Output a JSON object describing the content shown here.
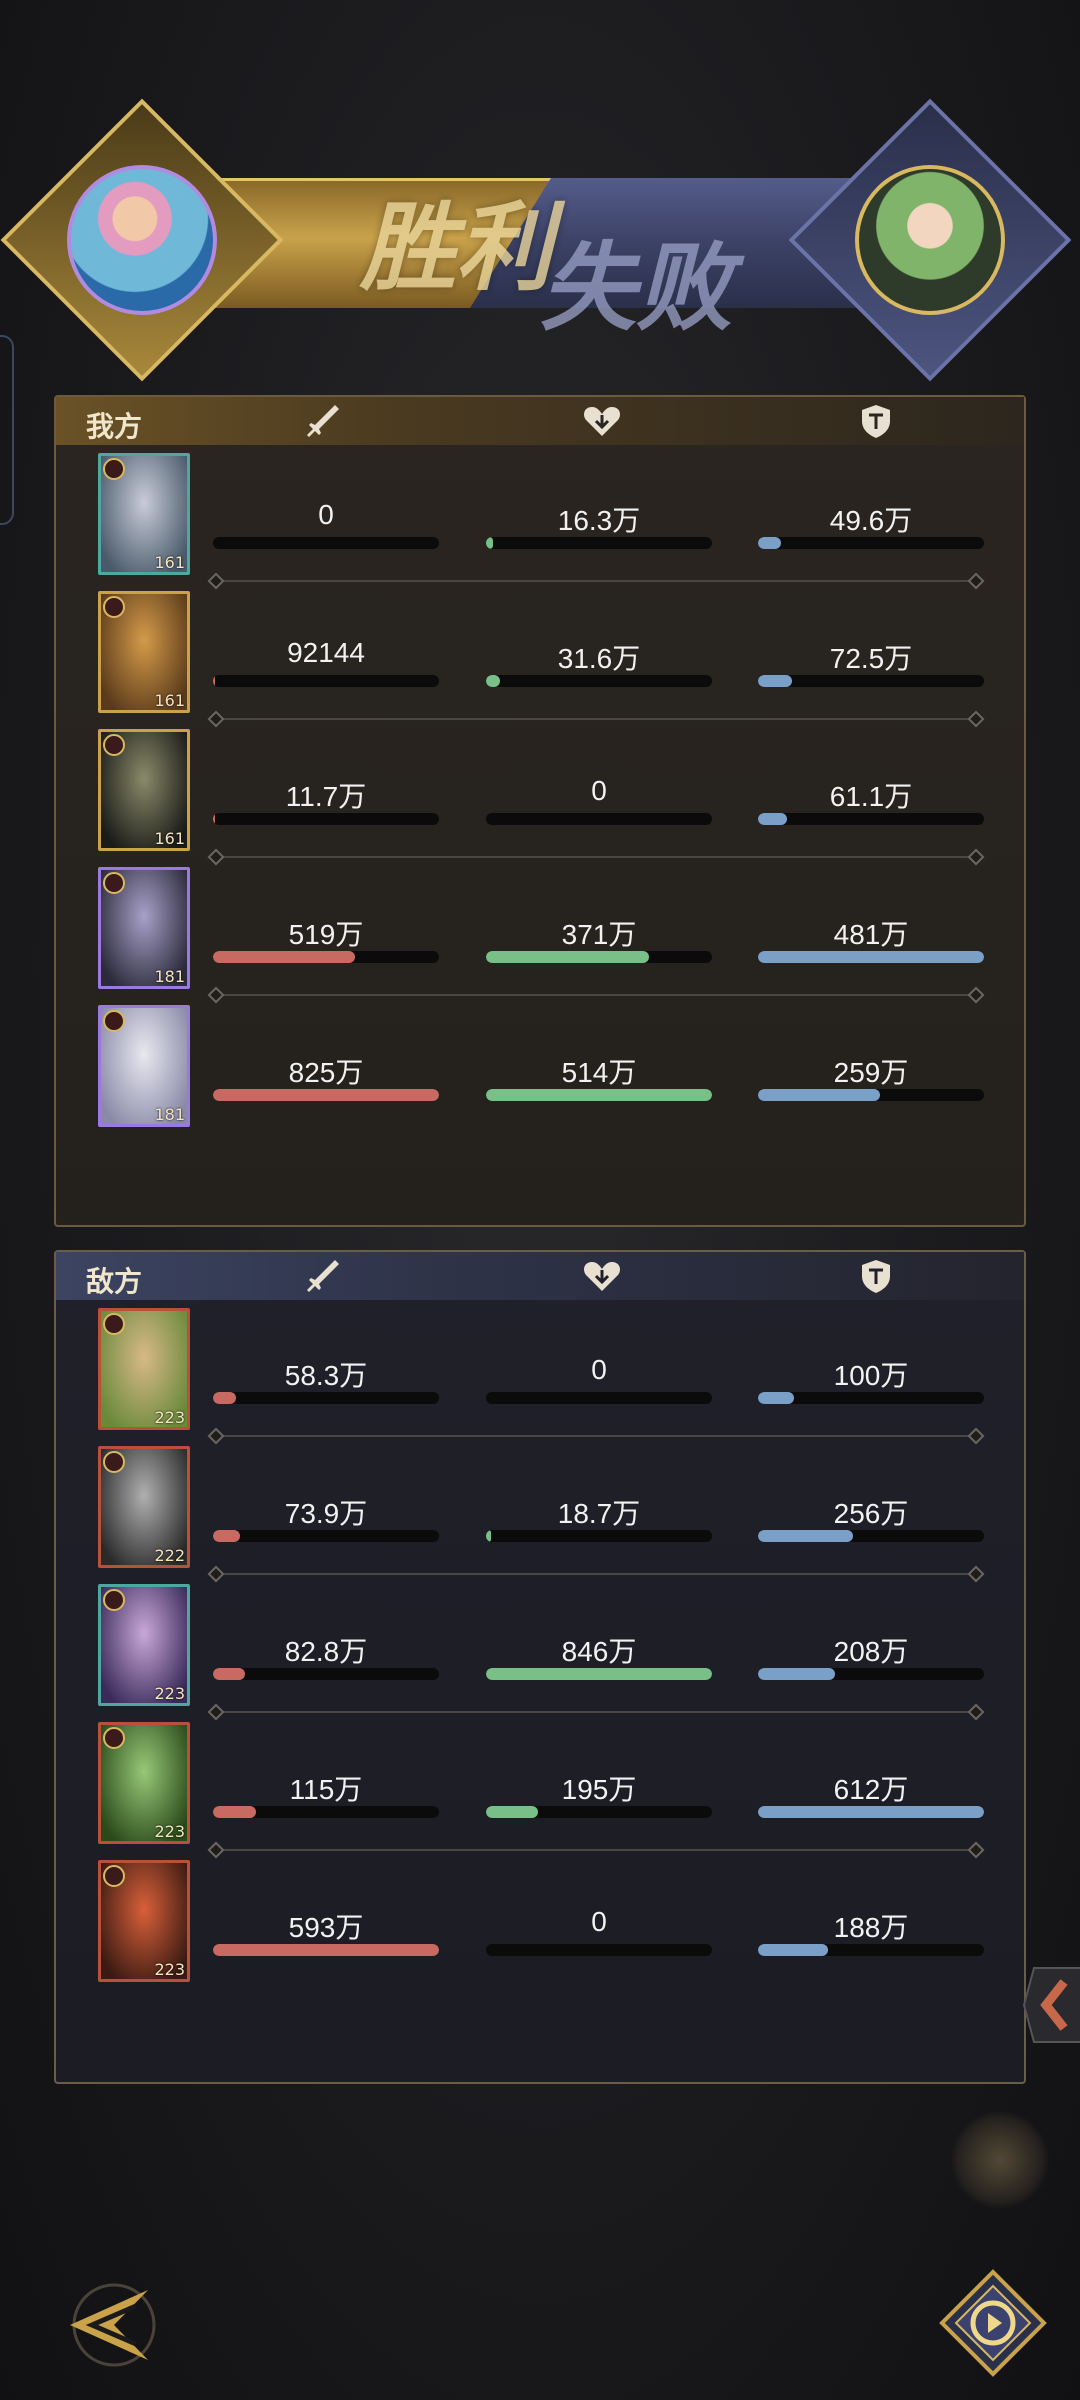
{
  "banner": {
    "victory_label": "胜利",
    "defeat_label": "失败"
  },
  "our_team": {
    "title": "我方",
    "members": [
      {
        "level": "161",
        "damage": "0",
        "damage_ratio": 0.0,
        "healing": "16.3万",
        "healing_ratio": 0.03,
        "tank": "49.6万",
        "tank_ratio": 0.1,
        "portrait_colors": [
          "#c8ccd8",
          "#4a5a6a"
        ],
        "frame": "#4fa8a0"
      },
      {
        "level": "161",
        "damage": "92144",
        "damage_ratio": 0.01,
        "healing": "31.6万",
        "healing_ratio": 0.06,
        "tank": "72.5万",
        "tank_ratio": 0.15,
        "portrait_colors": [
          "#d49a4a",
          "#5a3a1a"
        ],
        "frame": "#c9a24a"
      },
      {
        "level": "161",
        "damage": "11.7万",
        "damage_ratio": 0.01,
        "healing": "0",
        "healing_ratio": 0.0,
        "tank": "61.1万",
        "tank_ratio": 0.13,
        "portrait_colors": [
          "#8a8a6a",
          "#1a1a18"
        ],
        "frame": "#c9a24a"
      },
      {
        "level": "181",
        "damage": "519万",
        "damage_ratio": 0.63,
        "healing": "371万",
        "healing_ratio": 0.72,
        "tank": "481万",
        "tank_ratio": 1.0,
        "portrait_colors": [
          "#a8a0c8",
          "#2a2a3a"
        ],
        "frame": "#9a7ae0"
      },
      {
        "level": "181",
        "damage": "825万",
        "damage_ratio": 1.0,
        "healing": "514万",
        "healing_ratio": 1.0,
        "tank": "259万",
        "tank_ratio": 0.54,
        "portrait_colors": [
          "#e8e8f0",
          "#8a8aa8"
        ],
        "frame": "#9a7ae0"
      }
    ]
  },
  "enemy_team": {
    "title": "敌方",
    "members": [
      {
        "level": "223",
        "damage": "58.3万",
        "damage_ratio": 0.1,
        "healing": "0",
        "healing_ratio": 0.0,
        "tank": "100万",
        "tank_ratio": 0.16,
        "portrait_colors": [
          "#d8b888",
          "#6a8a3a"
        ],
        "frame": "#b8503a"
      },
      {
        "level": "222",
        "damage": "73.9万",
        "damage_ratio": 0.12,
        "healing": "18.7万",
        "healing_ratio": 0.02,
        "tank": "256万",
        "tank_ratio": 0.42,
        "portrait_colors": [
          "#b0b0b0",
          "#2a2a2a"
        ],
        "frame": "#b8503a"
      },
      {
        "level": "223",
        "damage": "82.8万",
        "damage_ratio": 0.14,
        "healing": "846万",
        "healing_ratio": 1.0,
        "tank": "208万",
        "tank_ratio": 0.34,
        "portrait_colors": [
          "#c8a8d8",
          "#3a2a5a"
        ],
        "frame": "#4fa8a0"
      },
      {
        "level": "223",
        "damage": "115万",
        "damage_ratio": 0.19,
        "healing": "195万",
        "healing_ratio": 0.23,
        "tank": "612万",
        "tank_ratio": 1.0,
        "portrait_colors": [
          "#98c878",
          "#2a4a1a"
        ],
        "frame": "#b8503a"
      },
      {
        "level": "223",
        "damage": "593万",
        "damage_ratio": 1.0,
        "healing": "0",
        "healing_ratio": 0.0,
        "tank": "188万",
        "tank_ratio": 0.31,
        "portrait_colors": [
          "#d8603a",
          "#3a1a12"
        ],
        "frame": "#b8503a"
      }
    ]
  },
  "columns": {
    "damage_icon": "sword-icon",
    "healing_icon": "heart-icon",
    "tank_icon": "shield-icon"
  },
  "colors": {
    "damage_bar": "#c96a62",
    "healing_bar": "#78bf88",
    "tank_bar": "#7aa0c8",
    "gold_accent": "#c9a24a"
  },
  "controls": {
    "back_icon": "back-arrow-icon",
    "replay_icon": "replay-icon"
  }
}
